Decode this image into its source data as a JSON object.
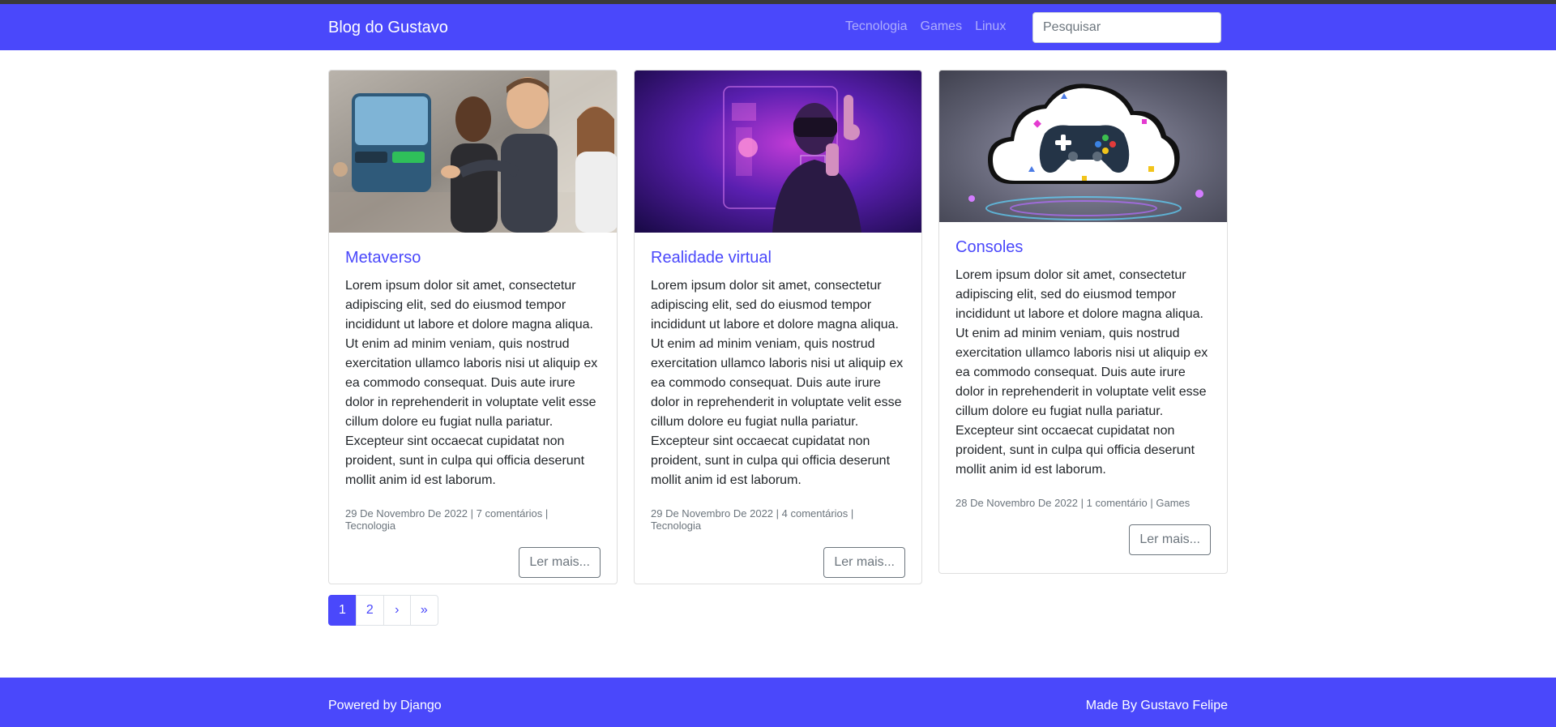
{
  "navbar": {
    "brand": "Blog do Gustavo",
    "links": [
      "Tecnologia",
      "Games",
      "Linux"
    ],
    "search_placeholder": "Pesquisar",
    "color": "#4a48fb"
  },
  "posts": [
    {
      "title": "Metaverso",
      "image": "metaverse-avatars-image",
      "text": "Lorem ipsum dolor sit amet, consectetur adipiscing elit, sed do eiusmod tempor incididunt ut labore et dolore magna aliqua. Ut enim ad minim veniam, quis nostrud exercitation ullamco laboris nisi ut aliquip ex ea commodo consequat. Duis aute irure dolor in reprehenderit in voluptate velit esse cillum dolore eu fugiat nulla pariatur. Excepteur sint occaecat cupidatat non proident, sunt in culpa qui officia deserunt mollit anim id est laborum.",
      "meta": "29 De Novembro De 2022 | 7 comentários | Tecnologia",
      "button": "Ler mais..."
    },
    {
      "title": "Realidade virtual",
      "image": "vr-headset-image",
      "text": "Lorem ipsum dolor sit amet, consectetur adipiscing elit, sed do eiusmod tempor incididunt ut labore et dolore magna aliqua. Ut enim ad minim veniam, quis nostrud exercitation ullamco laboris nisi ut aliquip ex ea commodo consequat. Duis aute irure dolor in reprehenderit in voluptate velit esse cillum dolore eu fugiat nulla pariatur. Excepteur sint occaecat cupidatat non proident, sunt in culpa qui officia deserunt mollit anim id est laborum.",
      "meta": "29 De Novembro De 2022 | 4 comentários | Tecnologia",
      "button": "Ler mais..."
    },
    {
      "title": "Consoles",
      "image": "gamepad-cloud-image",
      "text": "Lorem ipsum dolor sit amet, consectetur adipiscing elit, sed do eiusmod tempor incididunt ut labore et dolore magna aliqua. Ut enim ad minim veniam, quis nostrud exercitation ullamco laboris nisi ut aliquip ex ea commodo consequat. Duis aute irure dolor in reprehenderit in voluptate velit esse cillum dolore eu fugiat nulla pariatur. Excepteur sint occaecat cupidatat non proident, sunt in culpa qui officia deserunt mollit anim id est laborum.",
      "meta": "28 De Novembro De 2022 | 1 comentário | Games",
      "button": "Ler mais..."
    }
  ],
  "pagination": {
    "items": [
      "1",
      "2",
      "›",
      "»"
    ],
    "active": "1"
  },
  "footer": {
    "left": "Powered by Django",
    "right": "Made By Gustavo Felipe"
  }
}
